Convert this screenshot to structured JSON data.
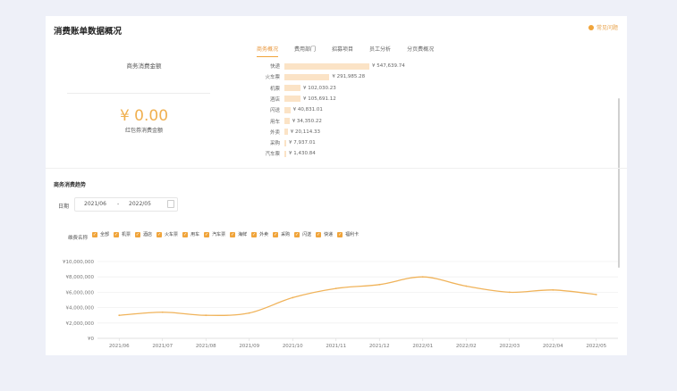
{
  "title": "消费账单数据概况",
  "feedback": "常见问题",
  "tabs": [
    "商务概况",
    "费用部门",
    "招募项目",
    "员工分析",
    "分页费概况"
  ],
  "total_label": "商务消费金额",
  "amount": "¥ 0.00",
  "amount_sub": "红包券消费金额",
  "breakdown": [
    {
      "label": "快递",
      "value": "¥ 547,639.74",
      "ratio": 1.0
    },
    {
      "label": "火车票",
      "value": "¥ 291,985.28",
      "ratio": 0.53
    },
    {
      "label": "机票",
      "value": "¥ 102,030.23",
      "ratio": 0.19
    },
    {
      "label": "酒店",
      "value": "¥ 105,691.12",
      "ratio": 0.19
    },
    {
      "label": "闪送",
      "value": "¥ 40,831.01",
      "ratio": 0.07
    },
    {
      "label": "用车",
      "value": "¥ 34,350.22",
      "ratio": 0.06
    },
    {
      "label": "外卖",
      "value": "¥ 20,114.33",
      "ratio": 0.04
    },
    {
      "label": "采购",
      "value": "¥ 7,937.01",
      "ratio": 0.015
    },
    {
      "label": "汽车票",
      "value": "¥ 1,430.84",
      "ratio": 0.003
    }
  ],
  "trend_title": "商务消费趋势",
  "date_label": "日期",
  "date_start": "2021/06",
  "date_sep": "-",
  "date_end": "2022/05",
  "filter_label": "维费名称",
  "filters": [
    "全部",
    "机票",
    "酒店",
    "火车票",
    "用车",
    "汽车票",
    "海鲜",
    "外卖",
    "采购",
    "闪送",
    "快递",
    "福利卡"
  ],
  "colors": {
    "accent": "#f0a43a",
    "line": "#f0b35a",
    "bar": "#fbe3c6"
  },
  "chart_data": {
    "type": "line",
    "x": [
      "2021/06",
      "2021/07",
      "2021/08",
      "2021/09",
      "2021/10",
      "2021/11",
      "2021/12",
      "2022/01",
      "2022/02",
      "2022/03",
      "2022/04",
      "2022/05"
    ],
    "series": [
      {
        "values": [
          3000000,
          3400000,
          3000000,
          3300000,
          5300000,
          6500000,
          7000000,
          8000000,
          6800000,
          6000000,
          6300000,
          5700000
        ]
      }
    ],
    "ylim": [
      0,
      10000000
    ],
    "yticks": [
      "¥0",
      "¥2,000,000",
      "¥4,000,000",
      "¥6,000,000",
      "¥8,000,000",
      "¥10,000,000"
    ],
    "grid": true
  }
}
